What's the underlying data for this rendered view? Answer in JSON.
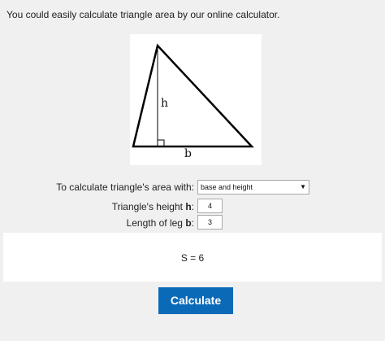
{
  "intro_text": "You could easily calculate triangle area by our online calculator.",
  "figure": {
    "height_label": "h",
    "base_label": "b"
  },
  "form": {
    "method_label": "To calculate triangle's area with:",
    "method_value": "base and height",
    "height_label_prefix": "Triangle's height ",
    "height_label_var": "h",
    "height_label_suffix": ":",
    "height_value": "4",
    "leg_label_prefix": "Length of leg ",
    "leg_label_var": "b",
    "leg_label_suffix": ":",
    "leg_value": "3"
  },
  "result": {
    "text": "S = 6"
  },
  "button": {
    "calculate_label": "Calculate",
    "color": "#0b6ab8"
  }
}
